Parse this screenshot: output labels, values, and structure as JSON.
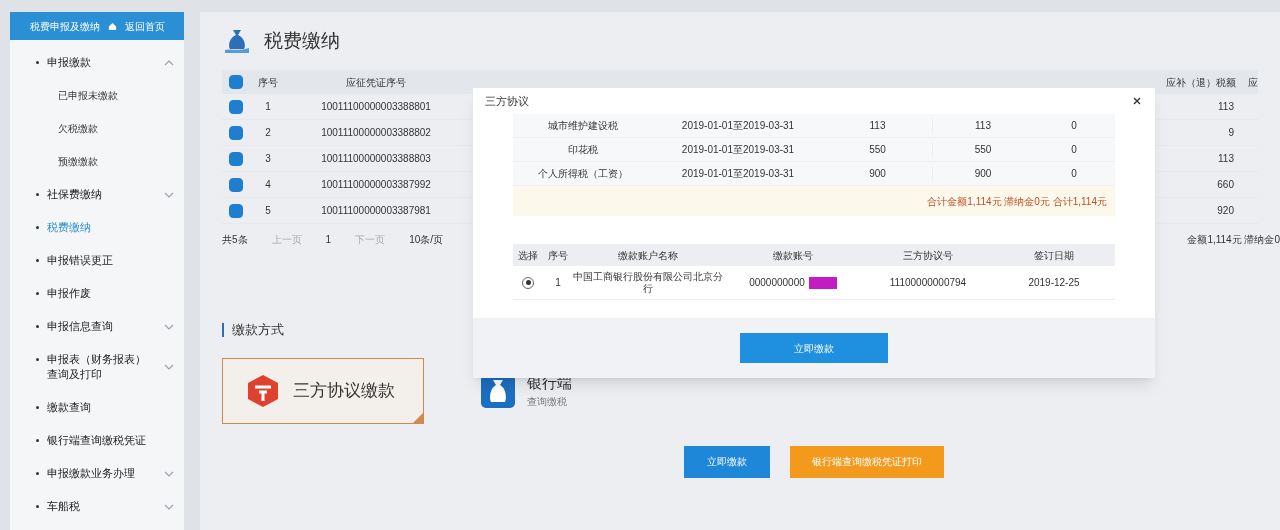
{
  "sidebar": {
    "top_button": {
      "label": "税费申报及缴纳",
      "link": "返回首页"
    },
    "items": [
      {
        "label": "申报缴款",
        "collapsible": true,
        "expanded": true,
        "selected": false,
        "children": [
          {
            "label": "已申报未缴款"
          },
          {
            "label": "欠税缴款"
          },
          {
            "label": "预缴缴款"
          }
        ]
      },
      {
        "label": "社保费缴纳",
        "collapsible": true,
        "expanded": false,
        "selected": false
      },
      {
        "label": "税费缴纳",
        "collapsible": false,
        "selected": true
      },
      {
        "label": "申报错误更正",
        "collapsible": false,
        "selected": false
      },
      {
        "label": "申报作废",
        "collapsible": false,
        "selected": false
      },
      {
        "label": "申报信息查询",
        "collapsible": true,
        "expanded": false,
        "selected": false
      },
      {
        "label": "申报表（财务报表）查询及打印",
        "collapsible": true,
        "expanded": false,
        "selected": false
      },
      {
        "label": "缴款查询",
        "collapsible": false,
        "selected": false
      },
      {
        "label": "银行端查询缴税凭证",
        "collapsible": false,
        "selected": false
      },
      {
        "label": "申报缴款业务办理",
        "collapsible": true,
        "expanded": false,
        "selected": false
      },
      {
        "label": "车船税",
        "collapsible": true,
        "expanded": false,
        "selected": false
      }
    ]
  },
  "page_title": "税费缴纳",
  "table": {
    "all_checked": true,
    "columns": [
      "序号",
      "应征凭证序号",
      "应补（退）税额",
      "应"
    ],
    "rows": [
      {
        "checked": true,
        "index": "1",
        "voucher": "10011100000003388801",
        "amount": "113"
      },
      {
        "checked": true,
        "index": "2",
        "voucher": "10011100000003388802",
        "amount": "9"
      },
      {
        "checked": true,
        "index": "3",
        "voucher": "10011100000003388803",
        "amount": "113"
      },
      {
        "checked": true,
        "index": "4",
        "voucher": "10011100000003387992",
        "amount": "660"
      },
      {
        "checked": true,
        "index": "5",
        "voucher": "10011100000003387981",
        "amount": "920"
      }
    ],
    "total_text": "金额1,114元  滞纳金0"
  },
  "pagination": {
    "total": "共5条",
    "prev": "上一页",
    "page": "1",
    "next": "下一页",
    "page_size": "10条/页"
  },
  "payment": {
    "title": "缴款方式",
    "methods": [
      {
        "kind": "agreement",
        "label": "三方协议缴款",
        "selected": true
      },
      {
        "kind": "bank",
        "label": "银行端",
        "sublabel": "查询缴税",
        "selected": false
      }
    ]
  },
  "buttons": [
    {
      "kind": "primary",
      "label": "立即缴款"
    },
    {
      "kind": "warning",
      "label": "银行端查询缴税凭证打印"
    }
  ],
  "dialog": {
    "title": "三方协议",
    "tax_rows": [
      {
        "name": "城市维护建设税",
        "period": "2019-01-01至2019-03-31",
        "amount": "113",
        "payable": "113",
        "late_fee": "0"
      },
      {
        "name": "印花税",
        "period": "2019-01-01至2019-03-31",
        "amount": "550",
        "payable": "550",
        "late_fee": "0"
      },
      {
        "name": "个人所得税（工资）",
        "period": "2019-01-01至2019-03-31",
        "amount": "900",
        "payable": "900",
        "late_fee": "0"
      }
    ],
    "summary": "合计金额1,114元  滞纳金0元  合计1,114元",
    "agreement_columns": [
      "选择",
      "序号",
      "缴款账户名称",
      "缴款账号",
      "三方协议号",
      "签订日期"
    ],
    "agreements": [
      {
        "selected": true,
        "index": "1",
        "bank": "中国工商银行股份有限公司北京分行",
        "account": "0000000000",
        "masked": true,
        "protocol": "11100000000794",
        "date": "2019-12-25"
      }
    ],
    "confirm": "立即缴款"
  }
}
